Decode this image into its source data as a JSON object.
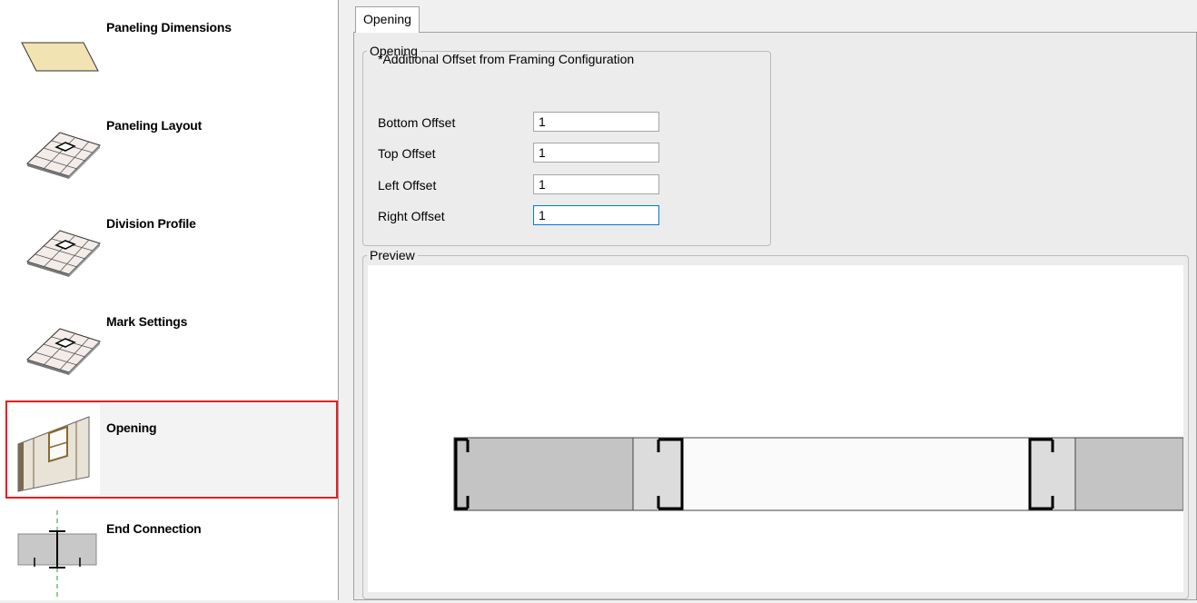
{
  "sidebar": {
    "items": [
      {
        "label": "Paneling Dimensions",
        "icon": "parallelogram-panel-icon"
      },
      {
        "label": "Paneling Layout",
        "icon": "panel-grid-icon"
      },
      {
        "label": "Division Profile",
        "icon": "panel-grid-icon"
      },
      {
        "label": "Mark Settings",
        "icon": "panel-grid-icon"
      },
      {
        "label": "Opening",
        "icon": "wall-opening-icon",
        "selected": true
      },
      {
        "label": "End Connection",
        "icon": "end-connection-icon"
      }
    ]
  },
  "tabs": [
    {
      "label": "Opening",
      "active": true
    }
  ],
  "opening_group": {
    "legend": "Opening",
    "note": "*Additional Offset from Framing Configuration",
    "fields": [
      {
        "label": "Bottom Offset",
        "value": "1"
      },
      {
        "label": "Top Offset",
        "value": "1"
      },
      {
        "label": "Left Offset",
        "value": "1"
      },
      {
        "label": "Right Offset",
        "value": "1"
      }
    ]
  },
  "preview_group": {
    "legend": "Preview"
  },
  "colors": {
    "selection_border": "#e02020",
    "input_focus": "#0078d7",
    "panel_dark": "#c4c4c4",
    "panel_light": "#dcdcdc",
    "panel_tan": "#f2e3b3"
  }
}
